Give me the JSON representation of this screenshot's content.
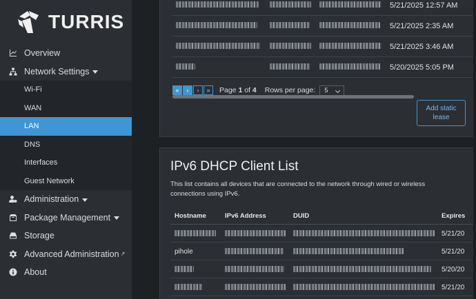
{
  "brand": {
    "name": "TURRIS"
  },
  "sidebar": {
    "items": [
      {
        "label": "Overview",
        "icon": "chart-line-icon"
      },
      {
        "label": "Network Settings",
        "icon": "network-icon",
        "expanded": true
      },
      {
        "label": "Administration",
        "icon": "user-gear-icon"
      },
      {
        "label": "Package Management",
        "icon": "box-icon"
      },
      {
        "label": "Storage",
        "icon": "hdd-icon"
      },
      {
        "label": "Advanced Administration",
        "icon": "gear-icon"
      },
      {
        "label": "About",
        "icon": "info-icon"
      }
    ],
    "network_sub": [
      "Wi-Fi",
      "WAN",
      "LAN",
      "DNS",
      "Interfaces",
      "Guest Network"
    ],
    "active_sub": "LAN"
  },
  "ipv4_table": {
    "rows": [
      {
        "expires": "5/21/2025 12:57 AM"
      },
      {
        "expires": "5/21/2025 2:35 AM"
      },
      {
        "expires": "5/21/2025 3:46 AM"
      },
      {
        "expires": "5/20/2025 5:05 PM"
      }
    ],
    "pager": {
      "first": "«",
      "prev": "‹",
      "next": "›",
      "last": "»",
      "page_prefix": "Page",
      "page": "1",
      "of_label": "of",
      "total": "4",
      "rows_per_page_label": "Rows per page:",
      "rows_per_page": "5"
    },
    "add_button": "Add static lease"
  },
  "ipv6": {
    "title": "IPv6 DHCP Client List",
    "description": "This list contains all devices that are connected to the network through wired or wireless connections using IPv6.",
    "columns": [
      "Hostname",
      "IPv6 Address",
      "DUID",
      "Expires"
    ],
    "rows": [
      {
        "hostname": "",
        "expires": "5/21/20"
      },
      {
        "hostname": "pihole",
        "expires": "5/21/20"
      },
      {
        "hostname": "",
        "expires": "5/20/20"
      },
      {
        "hostname": "",
        "expires": "5/21/20"
      }
    ]
  }
}
